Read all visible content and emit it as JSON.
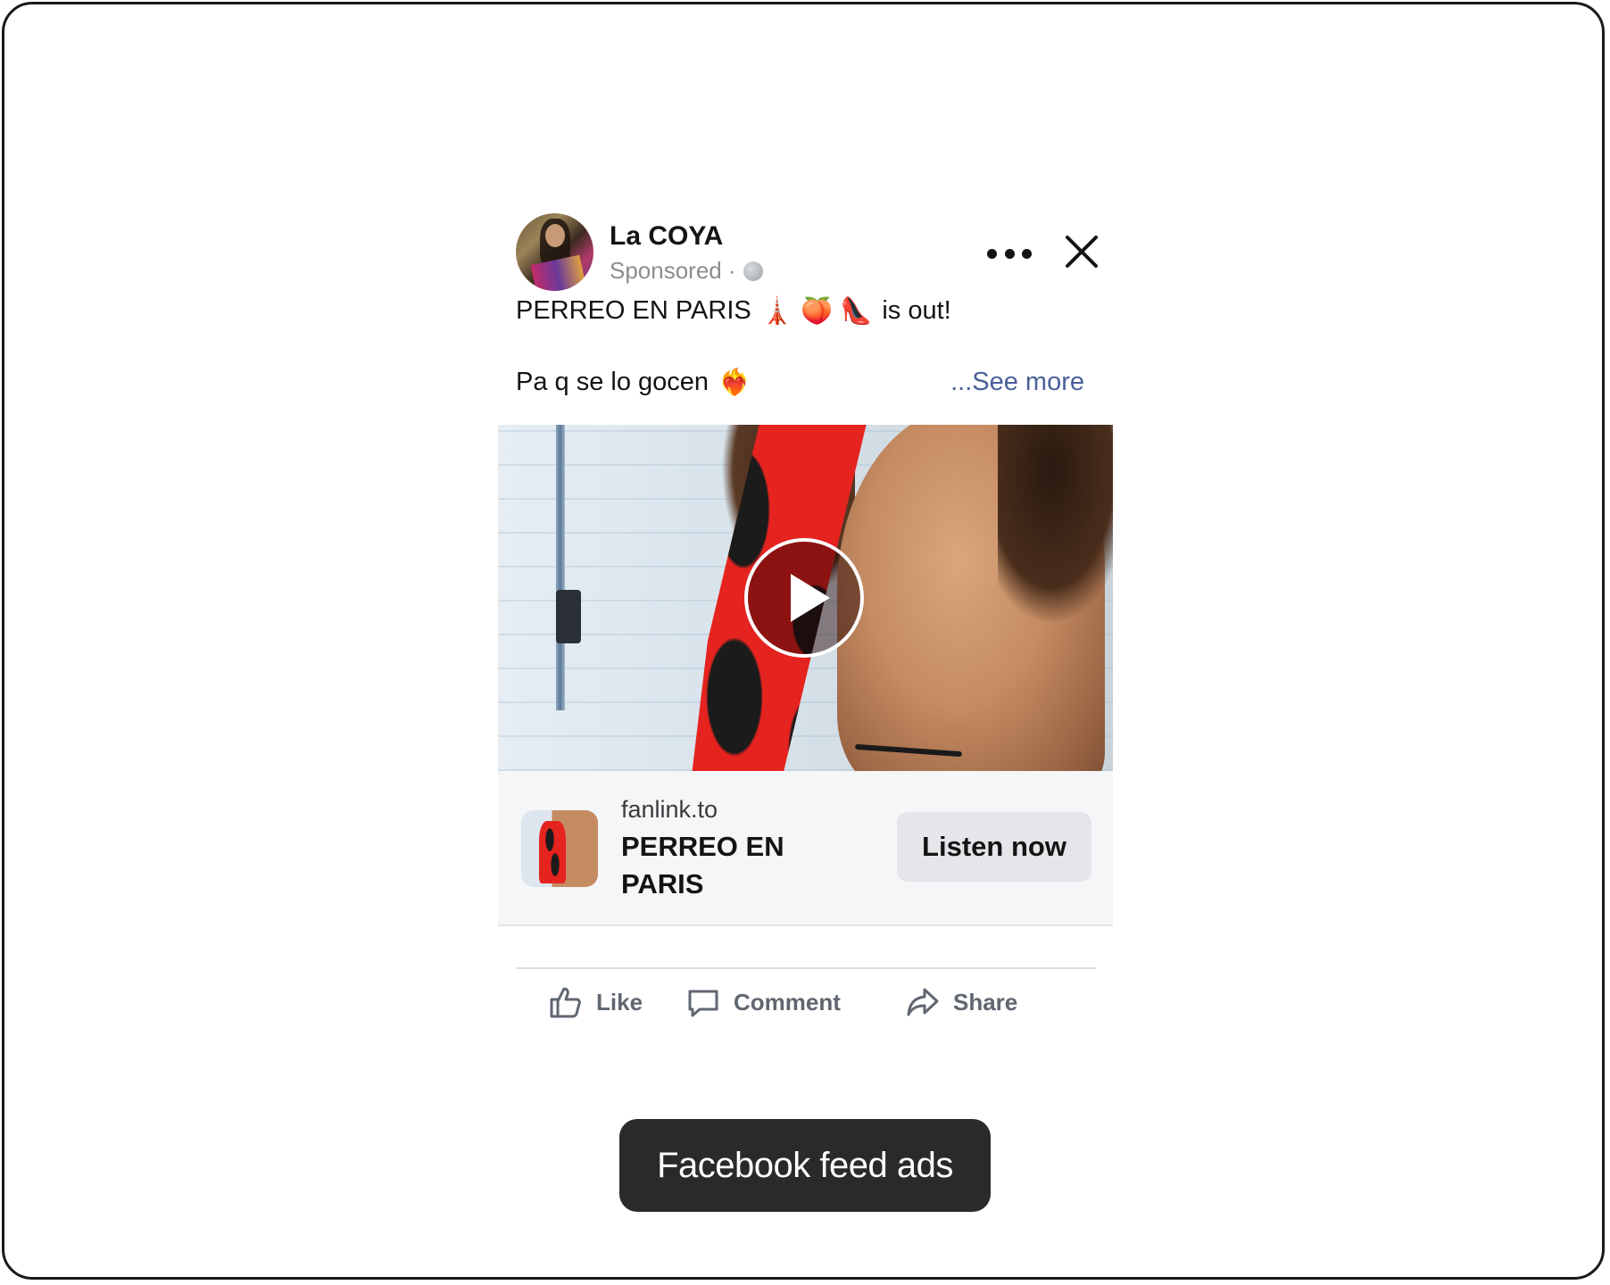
{
  "post": {
    "page_name": "La COYA",
    "sponsored": "Sponsored ·",
    "line1_text": "PERREO EN PARIS",
    "line1_emojis": "🗼 🍑 👠",
    "line1_suffix": "is out!",
    "line2_text": "Pa q se lo gocen",
    "line2_emoji": "❤️‍🔥",
    "see_more": "...See more"
  },
  "link": {
    "domain": "fanlink.to",
    "title": "PERREO EN PARIS",
    "cta": "Listen now"
  },
  "actions": {
    "like": "Like",
    "comment": "Comment",
    "share": "Share"
  },
  "caption": "Facebook feed ads",
  "colors": {
    "see_more": "#4a5f99",
    "action_text": "#606770",
    "cta_bg": "#e4e6ea",
    "caption_bg": "#2a2a2a"
  }
}
